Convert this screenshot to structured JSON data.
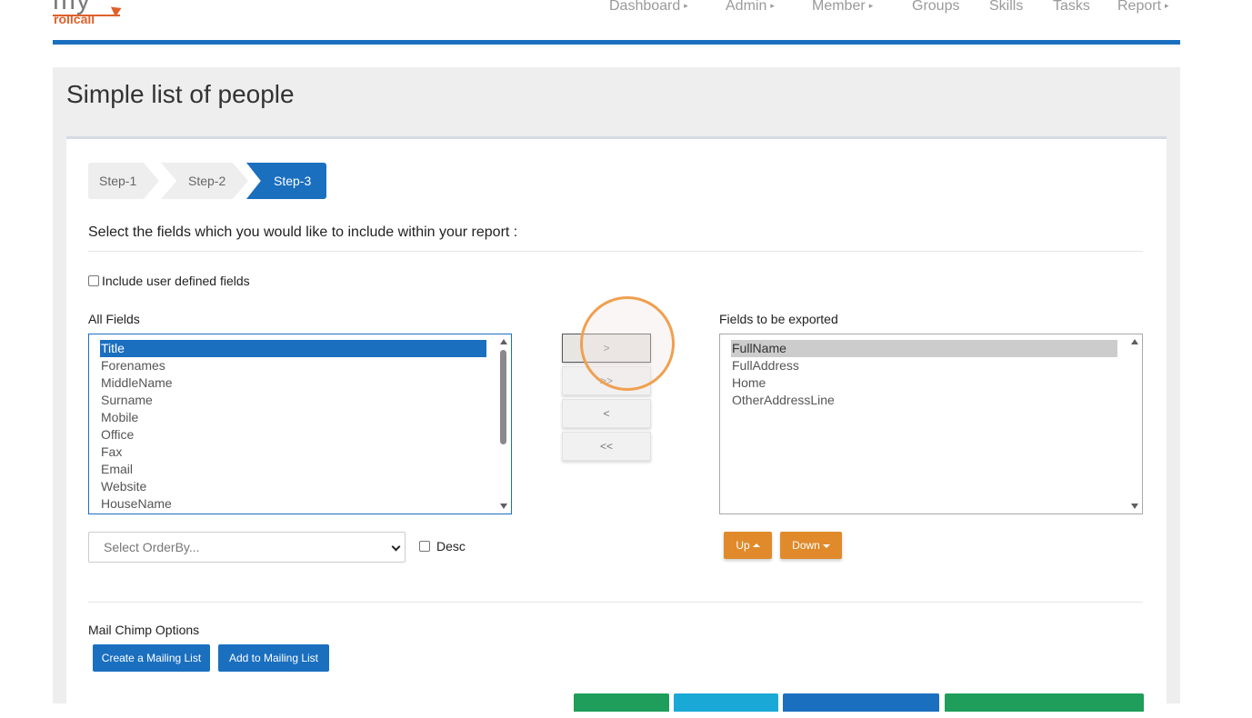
{
  "logo": {
    "my": "my",
    "rollcall": "rollcall"
  },
  "nav": {
    "items": [
      {
        "label": "Dashboard",
        "caret": true
      },
      {
        "label": "Admin",
        "caret": true
      },
      {
        "label": "Member",
        "caret": true
      },
      {
        "label": "Groups",
        "caret": false
      },
      {
        "label": "Skills",
        "caret": false
      },
      {
        "label": "Tasks",
        "caret": false
      },
      {
        "label": "Report",
        "caret": true
      }
    ],
    "caret_glyph": "▸"
  },
  "page": {
    "title": "Simple list of people"
  },
  "steps": [
    "Step-1",
    "Step-2",
    "Step-3"
  ],
  "instruction": "Select the fields which you would like to include within your report :",
  "udf_label": "Include user defined fields",
  "all_fields": {
    "label": "All Fields",
    "items": [
      "Title",
      "Forenames",
      "MiddleName",
      "Surname",
      "Mobile",
      "Office",
      "Fax",
      "Email",
      "Website",
      "HouseName"
    ],
    "selected": "Title"
  },
  "move_buttons": [
    ">",
    ">>",
    "<",
    "<<"
  ],
  "export_fields": {
    "label": "Fields to be exported",
    "items": [
      "FullName",
      "FullAddress",
      "Home",
      "OtherAddressLine"
    ],
    "selected": "FullName"
  },
  "orderby": {
    "placeholder": "Select OrderBy..."
  },
  "desc_label": "Desc",
  "up_label": "Up",
  "down_label": "Down",
  "mailchimp": {
    "label": "Mail Chimp Options",
    "create": "Create a Mailing List",
    "add": "Add to Mailing List"
  },
  "colors": {
    "accent_blue": "#1a6fbf",
    "orange": "#e08a2c",
    "green": "#1e9e5a",
    "cyan": "#1aa9d6",
    "highlight": "#f0a050"
  }
}
